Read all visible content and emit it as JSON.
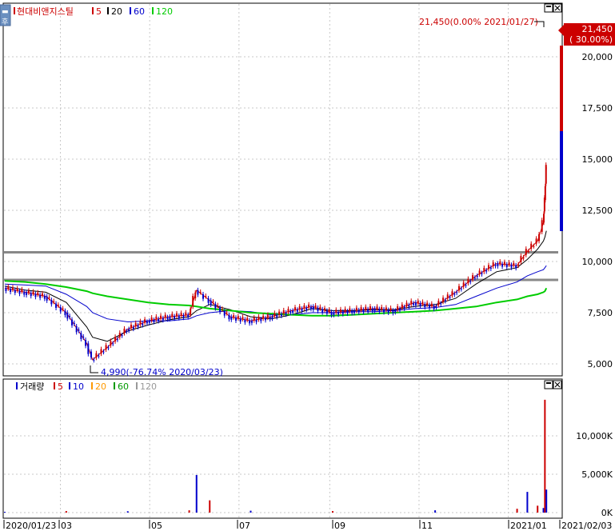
{
  "stock_name": "현대비앤지스틸",
  "price_legend": {
    "items": [
      {
        "label": "5",
        "color": "#cc0000"
      },
      {
        "label": "20",
        "color": "#000000"
      },
      {
        "label": "60",
        "color": "#0000cc"
      },
      {
        "label": "120",
        "color": "#00cc00"
      }
    ]
  },
  "volume_legend": {
    "title": "거래량",
    "items": [
      {
        "label": "5",
        "color": "#cc0000"
      },
      {
        "label": "10",
        "color": "#0000cc"
      },
      {
        "label": "20",
        "color": "#ff9900"
      },
      {
        "label": "60",
        "color": "#009900"
      },
      {
        "label": "120",
        "color": "#999999"
      }
    ]
  },
  "annotations": {
    "high": "21,450(0.00% 2021/01/27)",
    "low": "4,990(-76.74% 2020/03/23)",
    "last_price": "21,450",
    "last_change": "( 30.00%)"
  },
  "xaxis_labels": [
    "2020/01/23",
    "03",
    "05",
    "07",
    "09",
    "11",
    "2021/01",
    "2021/02/03"
  ],
  "colors": {
    "up": "#cc0000",
    "down": "#0000cc",
    "hline": "#888888",
    "grid": "#c8c8c8"
  },
  "chart_data": [
    {
      "type": "line",
      "title": "현대비앤지스틸",
      "xlabel": "",
      "ylabel": "",
      "x_range": [
        "2020/01/23",
        "2021/02/03"
      ],
      "ylim": [
        4500,
        22500
      ],
      "yticks": [
        5000,
        7500,
        10000,
        12500,
        15000,
        17500,
        20000
      ],
      "ytick_labels": [
        "5,000",
        "7,500",
        "10,000",
        "12,500",
        "15,000",
        "17,500",
        "20,000"
      ],
      "grid": true,
      "horizontal_lines": [
        10450,
        9100
      ],
      "x": [
        "2020/01/23",
        "2020/02/06",
        "2020/02/20",
        "2020/03/05",
        "2020/03/19",
        "2020/03/23",
        "2020/04/02",
        "2020/04/16",
        "2020/04/30",
        "2020/05/14",
        "2020/05/28",
        "2020/06/02",
        "2020/06/11",
        "2020/06/25",
        "2020/07/09",
        "2020/07/23",
        "2020/08/06",
        "2020/08/20",
        "2020/09/03",
        "2020/09/17",
        "2020/10/01",
        "2020/10/15",
        "2020/10/29",
        "2020/11/12",
        "2020/11/26",
        "2020/12/10",
        "2020/12/24",
        "2021/01/07",
        "2021/01/14",
        "2021/01/21",
        "2021/01/25",
        "2021/01/26",
        "2021/01/27"
      ],
      "series": [
        {
          "name": "5",
          "color": "#cc0000",
          "values": [
            8700,
            8500,
            8300,
            7500,
            6000,
            5200,
            5800,
            6700,
            7100,
            7300,
            7400,
            8600,
            8100,
            7300,
            7100,
            7300,
            7600,
            7800,
            7500,
            7600,
            7700,
            7600,
            8000,
            7800,
            8500,
            9300,
            9900,
            9800,
            10500,
            11000,
            11900,
            13000,
            14600
          ]
        },
        {
          "name": "20",
          "color": "#000000",
          "values": [
            8800,
            8600,
            8500,
            8000,
            6800,
            6300,
            6100,
            6600,
            6900,
            7150,
            7300,
            7600,
            7900,
            7650,
            7300,
            7200,
            7400,
            7700,
            7600,
            7600,
            7650,
            7650,
            7800,
            7900,
            8200,
            8900,
            9500,
            9700,
            10100,
            10600,
            11000,
            11200,
            11500
          ]
        },
        {
          "name": "60",
          "color": "#0000cc",
          "values": [
            8900,
            8850,
            8800,
            8400,
            7800,
            7500,
            7200,
            7050,
            7100,
            7100,
            7200,
            7350,
            7500,
            7600,
            7550,
            7400,
            7400,
            7500,
            7500,
            7550,
            7550,
            7600,
            7700,
            7750,
            7900,
            8300,
            8700,
            9000,
            9300,
            9500,
            9600,
            9700,
            9800
          ]
        },
        {
          "name": "120",
          "color": "#00cc00",
          "values": [
            9050,
            9000,
            8900,
            8750,
            8550,
            8450,
            8300,
            8150,
            8000,
            7900,
            7850,
            7800,
            7700,
            7600,
            7500,
            7450,
            7400,
            7350,
            7350,
            7400,
            7450,
            7500,
            7550,
            7600,
            7700,
            7800,
            8000,
            8150,
            8300,
            8400,
            8500,
            8550,
            8700
          ]
        }
      ]
    },
    {
      "type": "bar",
      "title": "거래량",
      "xlabel": "",
      "ylabel": "",
      "ylim": [
        0,
        15000
      ],
      "yticks": [
        0,
        5000,
        10000
      ],
      "ytick_labels": [
        "0K",
        "5,000K",
        "10,000K"
      ],
      "grid": true,
      "x": [
        "2020/01/23",
        "2020/03/05",
        "2020/04/16",
        "2020/05/28",
        "2020/06/02",
        "2020/06/11",
        "2020/07/09",
        "2020/09/03",
        "2020/11/12",
        "2021/01/07",
        "2021/01/14",
        "2021/01/21",
        "2021/01/25",
        "2021/01/26",
        "2021/01/27"
      ],
      "series": [
        {
          "name": "거래량",
          "values": [
            100,
            200,
            180,
            300,
            4900,
            1600,
            250,
            200,
            300,
            500,
            2700,
            900,
            600,
            14700,
            3000
          ]
        }
      ]
    }
  ]
}
